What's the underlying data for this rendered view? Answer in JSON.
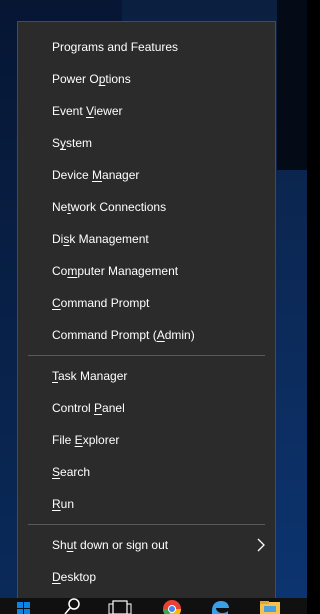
{
  "context_menu": {
    "group1": [
      {
        "label": "Programs and Features",
        "accel_index": 21
      },
      {
        "label": "Power Options",
        "accel_index": 7
      },
      {
        "label": "Event Viewer",
        "accel_index": 6
      },
      {
        "label": "System",
        "accel_index": 1
      },
      {
        "label": "Device Manager",
        "accel_index": 7
      },
      {
        "label": "Network Connections",
        "accel_index": 2
      },
      {
        "label": "Disk Management",
        "accel_index": 2
      },
      {
        "label": "Computer Management",
        "accel_index": 2
      },
      {
        "label": "Command Prompt",
        "accel_index": 0
      },
      {
        "label": "Command Prompt (Admin)",
        "accel_index": 16
      }
    ],
    "group2": [
      {
        "label": "Task Manager",
        "accel_index": 0
      },
      {
        "label": "Control Panel",
        "accel_index": 8
      },
      {
        "label": "File Explorer",
        "accel_index": 5
      },
      {
        "label": "Search",
        "accel_index": 0
      },
      {
        "label": "Run",
        "accel_index": 0
      }
    ],
    "group3": [
      {
        "label": "Shut down or sign out",
        "accel_index": 2,
        "submenu": true
      },
      {
        "label": "Desktop",
        "accel_index": 0
      }
    ]
  },
  "taskbar": {
    "icons": [
      "windows-start-icon",
      "search-icon",
      "task-view-icon",
      "chrome-icon",
      "edge-icon",
      "file-explorer-icon"
    ]
  },
  "colors": {
    "menu_bg": "#2b2b2b",
    "menu_text": "#ffffff",
    "separator": "#5a5a5a",
    "taskbar": "#101010",
    "accent_blue": "#0078d7"
  }
}
